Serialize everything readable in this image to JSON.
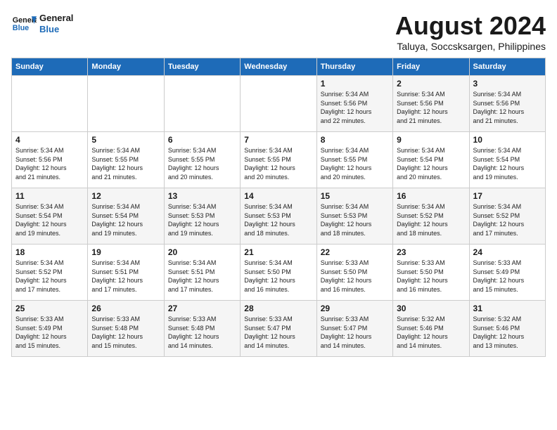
{
  "header": {
    "logo_line1": "General",
    "logo_line2": "Blue",
    "month_year": "August 2024",
    "location": "Taluya, Soccsksargen, Philippines"
  },
  "weekdays": [
    "Sunday",
    "Monday",
    "Tuesday",
    "Wednesday",
    "Thursday",
    "Friday",
    "Saturday"
  ],
  "weeks": [
    [
      {
        "day": "",
        "info": ""
      },
      {
        "day": "",
        "info": ""
      },
      {
        "day": "",
        "info": ""
      },
      {
        "day": "",
        "info": ""
      },
      {
        "day": "1",
        "info": "Sunrise: 5:34 AM\nSunset: 5:56 PM\nDaylight: 12 hours\nand 22 minutes."
      },
      {
        "day": "2",
        "info": "Sunrise: 5:34 AM\nSunset: 5:56 PM\nDaylight: 12 hours\nand 21 minutes."
      },
      {
        "day": "3",
        "info": "Sunrise: 5:34 AM\nSunset: 5:56 PM\nDaylight: 12 hours\nand 21 minutes."
      }
    ],
    [
      {
        "day": "4",
        "info": "Sunrise: 5:34 AM\nSunset: 5:56 PM\nDaylight: 12 hours\nand 21 minutes."
      },
      {
        "day": "5",
        "info": "Sunrise: 5:34 AM\nSunset: 5:55 PM\nDaylight: 12 hours\nand 21 minutes."
      },
      {
        "day": "6",
        "info": "Sunrise: 5:34 AM\nSunset: 5:55 PM\nDaylight: 12 hours\nand 20 minutes."
      },
      {
        "day": "7",
        "info": "Sunrise: 5:34 AM\nSunset: 5:55 PM\nDaylight: 12 hours\nand 20 minutes."
      },
      {
        "day": "8",
        "info": "Sunrise: 5:34 AM\nSunset: 5:55 PM\nDaylight: 12 hours\nand 20 minutes."
      },
      {
        "day": "9",
        "info": "Sunrise: 5:34 AM\nSunset: 5:54 PM\nDaylight: 12 hours\nand 20 minutes."
      },
      {
        "day": "10",
        "info": "Sunrise: 5:34 AM\nSunset: 5:54 PM\nDaylight: 12 hours\nand 19 minutes."
      }
    ],
    [
      {
        "day": "11",
        "info": "Sunrise: 5:34 AM\nSunset: 5:54 PM\nDaylight: 12 hours\nand 19 minutes."
      },
      {
        "day": "12",
        "info": "Sunrise: 5:34 AM\nSunset: 5:54 PM\nDaylight: 12 hours\nand 19 minutes."
      },
      {
        "day": "13",
        "info": "Sunrise: 5:34 AM\nSunset: 5:53 PM\nDaylight: 12 hours\nand 19 minutes."
      },
      {
        "day": "14",
        "info": "Sunrise: 5:34 AM\nSunset: 5:53 PM\nDaylight: 12 hours\nand 18 minutes."
      },
      {
        "day": "15",
        "info": "Sunrise: 5:34 AM\nSunset: 5:53 PM\nDaylight: 12 hours\nand 18 minutes."
      },
      {
        "day": "16",
        "info": "Sunrise: 5:34 AM\nSunset: 5:52 PM\nDaylight: 12 hours\nand 18 minutes."
      },
      {
        "day": "17",
        "info": "Sunrise: 5:34 AM\nSunset: 5:52 PM\nDaylight: 12 hours\nand 17 minutes."
      }
    ],
    [
      {
        "day": "18",
        "info": "Sunrise: 5:34 AM\nSunset: 5:52 PM\nDaylight: 12 hours\nand 17 minutes."
      },
      {
        "day": "19",
        "info": "Sunrise: 5:34 AM\nSunset: 5:51 PM\nDaylight: 12 hours\nand 17 minutes."
      },
      {
        "day": "20",
        "info": "Sunrise: 5:34 AM\nSunset: 5:51 PM\nDaylight: 12 hours\nand 17 minutes."
      },
      {
        "day": "21",
        "info": "Sunrise: 5:34 AM\nSunset: 5:50 PM\nDaylight: 12 hours\nand 16 minutes."
      },
      {
        "day": "22",
        "info": "Sunrise: 5:33 AM\nSunset: 5:50 PM\nDaylight: 12 hours\nand 16 minutes."
      },
      {
        "day": "23",
        "info": "Sunrise: 5:33 AM\nSunset: 5:50 PM\nDaylight: 12 hours\nand 16 minutes."
      },
      {
        "day": "24",
        "info": "Sunrise: 5:33 AM\nSunset: 5:49 PM\nDaylight: 12 hours\nand 15 minutes."
      }
    ],
    [
      {
        "day": "25",
        "info": "Sunrise: 5:33 AM\nSunset: 5:49 PM\nDaylight: 12 hours\nand 15 minutes."
      },
      {
        "day": "26",
        "info": "Sunrise: 5:33 AM\nSunset: 5:48 PM\nDaylight: 12 hours\nand 15 minutes."
      },
      {
        "day": "27",
        "info": "Sunrise: 5:33 AM\nSunset: 5:48 PM\nDaylight: 12 hours\nand 14 minutes."
      },
      {
        "day": "28",
        "info": "Sunrise: 5:33 AM\nSunset: 5:47 PM\nDaylight: 12 hours\nand 14 minutes."
      },
      {
        "day": "29",
        "info": "Sunrise: 5:33 AM\nSunset: 5:47 PM\nDaylight: 12 hours\nand 14 minutes."
      },
      {
        "day": "30",
        "info": "Sunrise: 5:32 AM\nSunset: 5:46 PM\nDaylight: 12 hours\nand 14 minutes."
      },
      {
        "day": "31",
        "info": "Sunrise: 5:32 AM\nSunset: 5:46 PM\nDaylight: 12 hours\nand 13 minutes."
      }
    ]
  ]
}
